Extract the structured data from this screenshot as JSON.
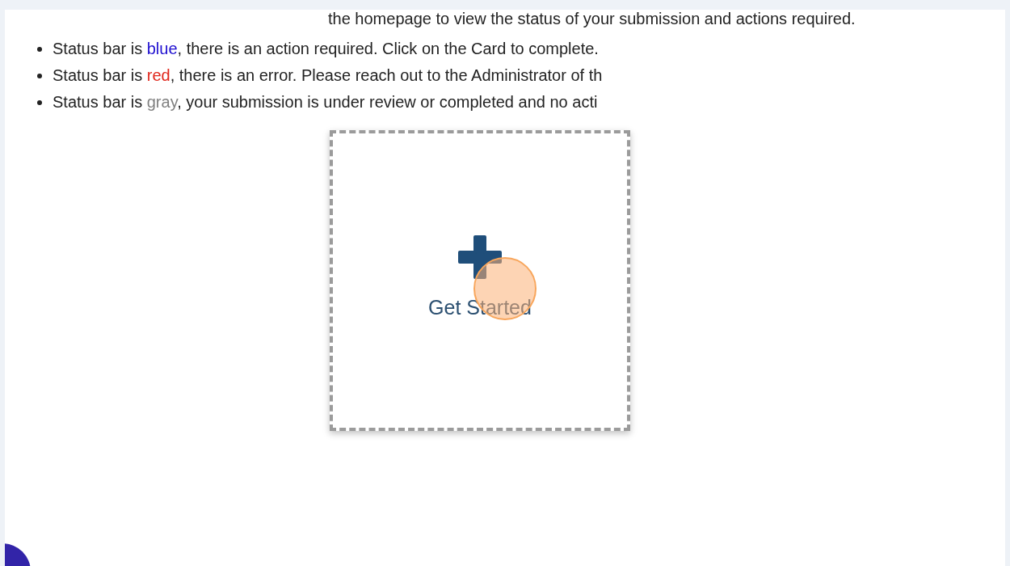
{
  "intro": "the homepage to view the status of your submission and actions required.",
  "status_items": [
    {
      "lead": "Status bar is ",
      "status": "blue",
      "color": "#1f0fd0",
      "rest": ", there is an action required. Click on the Card to complete."
    },
    {
      "lead": "Status bar is ",
      "status": "red",
      "color": "#e0261b",
      "rest": ", there is an error. Please reach out to the Administrator of th"
    },
    {
      "lead": "Status bar is ",
      "status": "gray",
      "color": "#808080",
      "rest": ", your submission is under review or completed and no acti"
    }
  ],
  "card": {
    "label": "Get Started"
  }
}
